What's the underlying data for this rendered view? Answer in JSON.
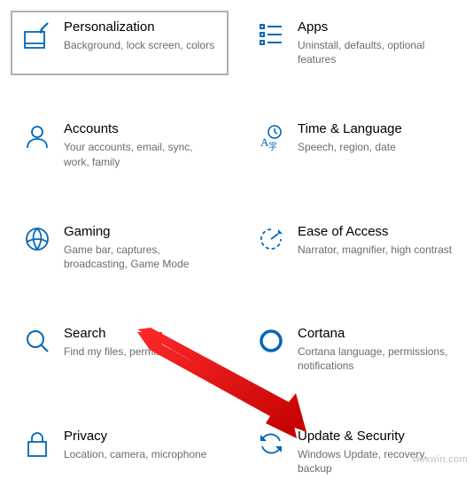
{
  "accent": "#0067b8",
  "tiles": [
    {
      "title": "Personalization",
      "desc": "Background, lock screen, colors"
    },
    {
      "title": "Apps",
      "desc": "Uninstall, defaults, optional features"
    },
    {
      "title": "Accounts",
      "desc": "Your accounts, email, sync, work, family"
    },
    {
      "title": "Time & Language",
      "desc": "Speech, region, date"
    },
    {
      "title": "Gaming",
      "desc": "Game bar, captures, broadcasting, Game Mode"
    },
    {
      "title": "Ease of Access",
      "desc": "Narrator, magnifier, high contrast"
    },
    {
      "title": "Search",
      "desc": "Find my files, permissions"
    },
    {
      "title": "Cortana",
      "desc": "Cortana language, permissions, notifications"
    },
    {
      "title": "Privacy",
      "desc": "Location, camera, microphone"
    },
    {
      "title": "Update & Security",
      "desc": "Windows Update, recovery, backup"
    }
  ],
  "watermark": "wsxwin.com"
}
